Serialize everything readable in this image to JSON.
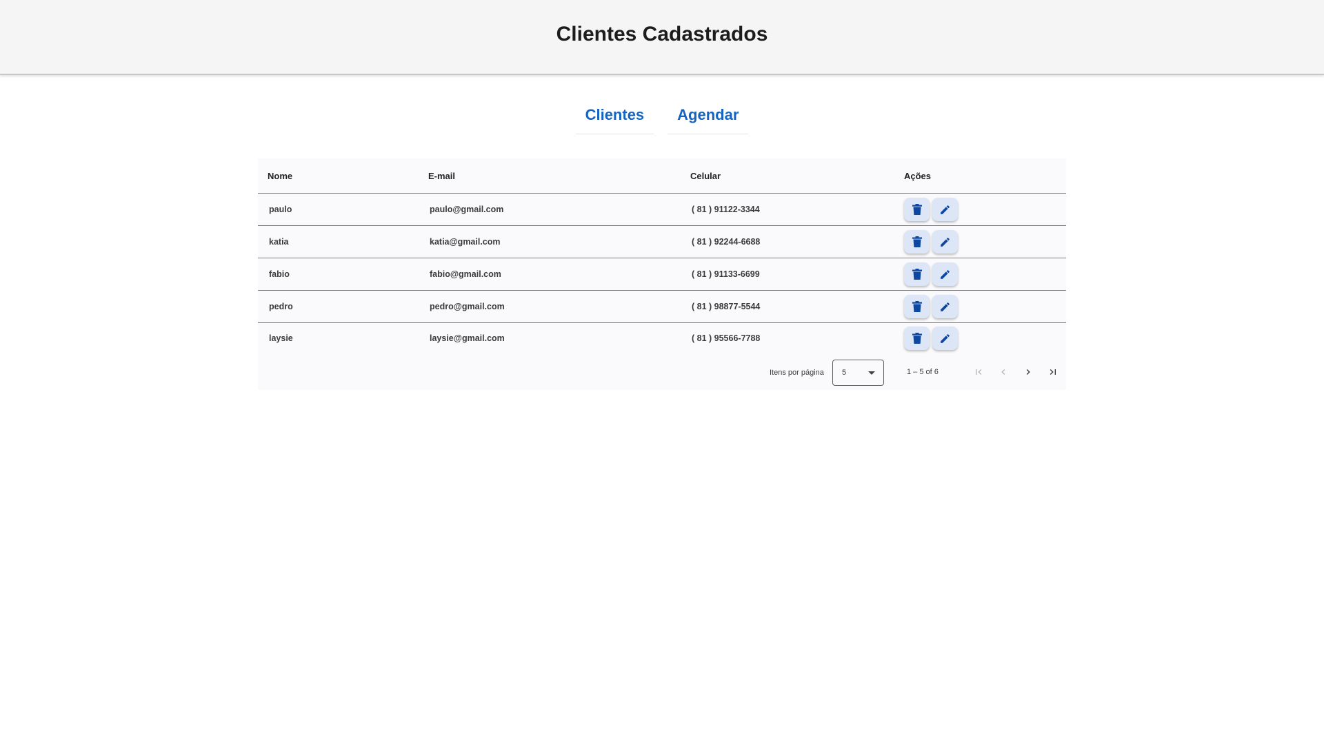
{
  "header": {
    "title": "Clientes Cadastrados"
  },
  "nav": {
    "clientes": "Clientes",
    "agendar": "Agendar"
  },
  "table": {
    "headers": {
      "nome": "Nome",
      "email": "E-mail",
      "celular": "Celular",
      "acoes": "Ações"
    },
    "rows": [
      {
        "nome": "paulo",
        "email": "paulo@gmail.com",
        "celular": "( 81 ) 91122-3344"
      },
      {
        "nome": "katia",
        "email": "katia@gmail.com",
        "celular": "( 81 ) 92244-6688"
      },
      {
        "nome": "fabio",
        "email": "fabio@gmail.com",
        "celular": "( 81 ) 91133-6699"
      },
      {
        "nome": "pedro",
        "email": "pedro@gmail.com",
        "celular": "( 81 ) 98877-5544"
      },
      {
        "nome": "laysie",
        "email": "laysie@gmail.com",
        "celular": "( 81 ) 95566-7788"
      }
    ]
  },
  "paginator": {
    "items_label": "Itens por página",
    "page_size": "5",
    "range": "1 – 5 of 6"
  },
  "icons": {
    "delete": "trash-icon",
    "edit": "pencil-icon",
    "first": "first-page-icon",
    "prev": "chevron-left-icon",
    "next": "chevron-right-icon",
    "last": "last-page-icon"
  },
  "colors": {
    "accent": "#1565c0",
    "action_icon": "#0d47a1",
    "action_bg": "#dde6f7",
    "header_bg": "#f5f5f6"
  }
}
